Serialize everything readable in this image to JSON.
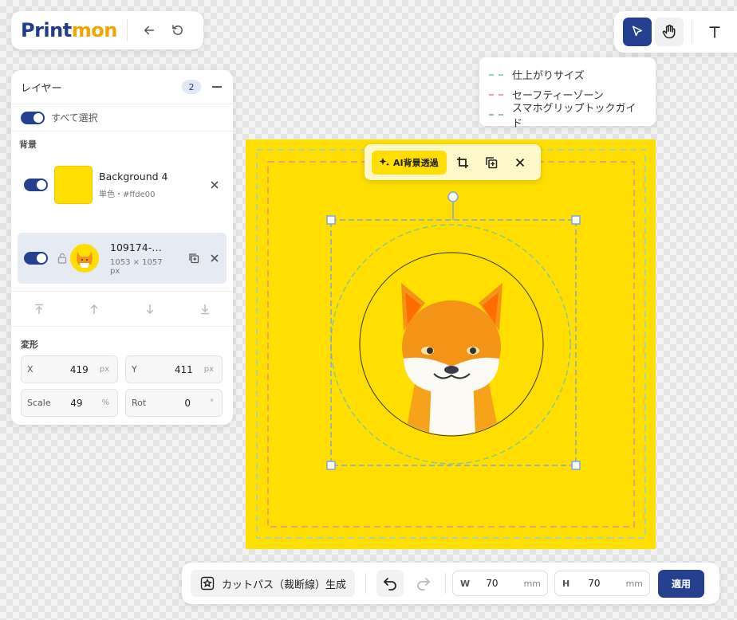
{
  "brand": {
    "part1": "Print",
    "part2": "mon"
  },
  "header": {
    "back_icon": "arrow-left-icon",
    "reset_icon": "rotate-ccw-icon"
  },
  "tools": {
    "select_icon": "cursor-arrow-icon",
    "hand_icon": "hand-icon",
    "text_icon": "text-icon",
    "active": "select"
  },
  "guides": {
    "items": [
      {
        "label": "仕上がりサイズ",
        "color": "#8fd3d3"
      },
      {
        "label": "セーフティーゾーン",
        "color": "#f0a0a0"
      },
      {
        "label": "スマホグリップトックガイド",
        "color": "#86c98c"
      }
    ]
  },
  "layers_panel": {
    "title": "レイヤー",
    "count": "2",
    "select_all_label": "すべて選択",
    "background_section_label": "背景",
    "background_layer": {
      "name": "Background 4",
      "detail": "単色・#ffde00",
      "color": "#ffde00",
      "visible": true
    },
    "image_layer": {
      "name": "109174-…",
      "size": "1053 × 1057",
      "unit": "px",
      "visible": true,
      "locked": false
    },
    "transform": {
      "title": "変形",
      "x_label": "X",
      "x_value": "419",
      "x_unit": "px",
      "y_label": "Y",
      "y_value": "411",
      "y_unit": "px",
      "scale_label": "Scale",
      "scale_value": "49",
      "scale_unit": "%",
      "rot_label": "Rot",
      "rot_value": "0",
      "rot_unit": "°"
    }
  },
  "float_toolbar": {
    "ai_label": "AI背景透過",
    "ai_icon": "sparkles-icon",
    "crop_icon": "crop-icon",
    "duplicate_icon": "duplicate-icon",
    "close_icon": "close-icon"
  },
  "bottom_bar": {
    "cutpath_label": "カットパス（裁断線）生成",
    "w_label": "W",
    "w_value": "70",
    "w_unit": "mm",
    "h_label": "H",
    "h_value": "70",
    "h_unit": "mm",
    "apply_label": "適用"
  },
  "colors": {
    "brand_primary": "#1e3d8f",
    "brand_accent": "#f0a500",
    "canvas_bg": "#ffde00",
    "button_primary": "#24408e"
  }
}
